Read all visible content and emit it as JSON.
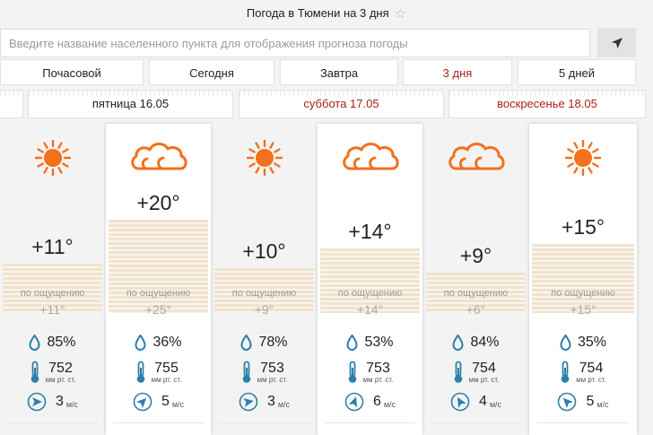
{
  "header": {
    "title": "Погода в Тюмени на 3 дня"
  },
  "search": {
    "placeholder": "Введите название населенного пункта для отображения прогноза погоды"
  },
  "tabs": [
    {
      "label": "Почасовой",
      "active": false
    },
    {
      "label": "Сегодня",
      "active": false
    },
    {
      "label": "Завтра",
      "active": false
    },
    {
      "label": "3 дня",
      "active": true
    },
    {
      "label": "5 дней",
      "active": false
    }
  ],
  "days": [
    {
      "label": "пятница 16.05",
      "weekend": false
    },
    {
      "label": "суббота 17.05",
      "weekend": true
    },
    {
      "label": "воскресенье 18.05",
      "weekend": true
    }
  ],
  "feel_label": "по ощущению",
  "pressure_unit": "мм рт. ст.",
  "wind_unit": "м/с",
  "colors": {
    "sun": "#f2711c",
    "cloud": "#f2711c",
    "weekend": "#a8201a",
    "drop": "#2c7fa8"
  },
  "periods": [
    {
      "icon": "sun-icon",
      "temp": "+11°",
      "temp_value": 11,
      "feel": "+11°",
      "humidity": "85%",
      "pressure": "752",
      "wind": "3",
      "wind_dir_deg": 90
    },
    {
      "icon": "cloud-icon",
      "temp": "+20°",
      "temp_value": 20,
      "feel": "+25°",
      "humidity": "36%",
      "pressure": "755",
      "wind": "5",
      "wind_dir_deg": 45
    },
    {
      "icon": "sun-icon",
      "temp": "+10°",
      "temp_value": 10,
      "feel": "+9°",
      "humidity": "78%",
      "pressure": "753",
      "wind": "3",
      "wind_dir_deg": 80
    },
    {
      "icon": "cloud-icon",
      "temp": "+14°",
      "temp_value": 14,
      "feel": "+14°",
      "humidity": "53%",
      "pressure": "753",
      "wind": "6",
      "wind_dir_deg": 20
    },
    {
      "icon": "cloud-icon",
      "temp": "+9°",
      "temp_value": 9,
      "feel": "+6°",
      "humidity": "84%",
      "pressure": "754",
      "wind": "4",
      "wind_dir_deg": 330
    },
    {
      "icon": "sun-icon",
      "temp": "+15°",
      "temp_value": 15,
      "feel": "+15°",
      "humidity": "35%",
      "pressure": "754",
      "wind": "5",
      "wind_dir_deg": 315
    }
  ]
}
